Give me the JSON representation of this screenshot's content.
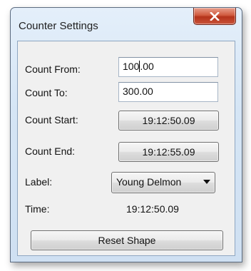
{
  "window": {
    "title": "Counter Settings"
  },
  "form": {
    "count_from": {
      "label": "Count From:",
      "value_before_caret": "100",
      "value_after_caret": ".00"
    },
    "count_to": {
      "label": "Count To:",
      "value": "300.00"
    },
    "count_start": {
      "label": "Count Start:",
      "button_value": "19:12:50.09"
    },
    "count_end": {
      "label": "Count End:",
      "button_value": "19:12:55.09"
    },
    "label_field": {
      "label": "Label:",
      "selected": "Young Delmon"
    },
    "time": {
      "label": "Time:",
      "value": "19:12:50.09"
    }
  },
  "actions": {
    "reset_label": "Reset Shape"
  },
  "icons": {
    "close": "close-icon",
    "dropdown": "chevron-down-icon"
  },
  "colors": {
    "close_button": "#c9553a",
    "title_bar": "#dce9f6",
    "client_bg": "#f0f0f0"
  }
}
